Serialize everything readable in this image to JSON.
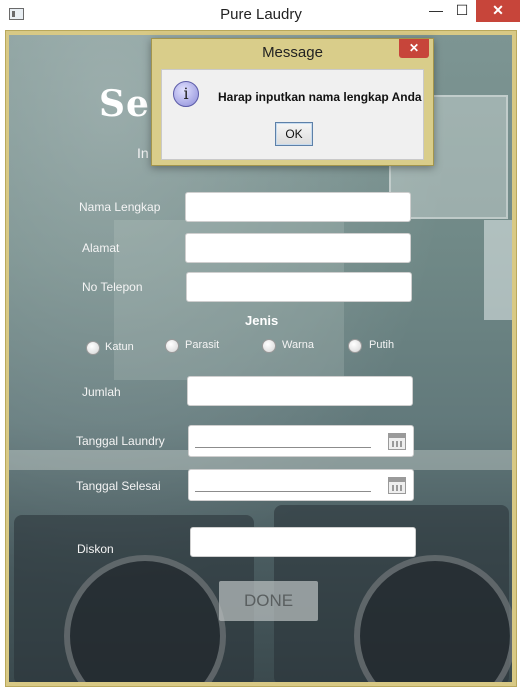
{
  "window": {
    "title": "Pure Laudry",
    "minimize": "—",
    "maximize": "☐",
    "close": "✕"
  },
  "form": {
    "heading": "Sel",
    "subheading": "In",
    "labels": {
      "nama": "Nama Lengkap",
      "alamat": "Alamat",
      "telepon": "No Telepon",
      "jenis": "Jenis",
      "jumlah": "Jumlah",
      "tgl_laundry": "Tanggal Laundry",
      "tgl_selesai": "Tanggal Selesai",
      "diskon": "Diskon"
    },
    "values": {
      "nama": "",
      "alamat": "",
      "telepon": "",
      "jumlah": "",
      "tgl_laundry": "",
      "tgl_selesai": "",
      "diskon": ""
    },
    "radios": [
      {
        "label": "Katun",
        "selected": false
      },
      {
        "label": "Parasit",
        "selected": false
      },
      {
        "label": "Warna",
        "selected": false
      },
      {
        "label": "Putih",
        "selected": false
      }
    ],
    "done_label": "DONE",
    "calendar_icon": "calendar-icon"
  },
  "dialog": {
    "title": "Message",
    "close": "✕",
    "icon": "info-icon",
    "icon_glyph": "i",
    "message": "Harap inputkan nama lengkap Anda",
    "ok_label": "OK"
  }
}
